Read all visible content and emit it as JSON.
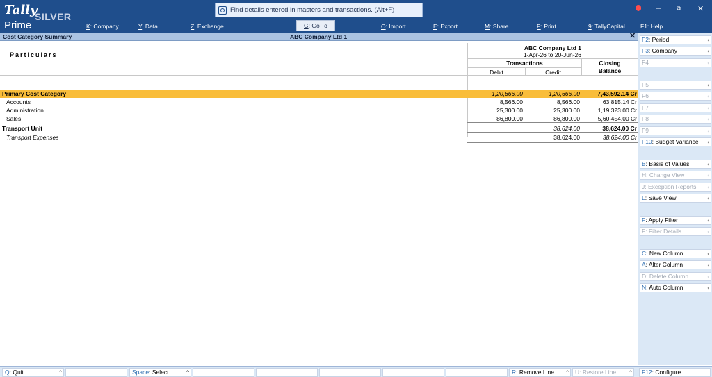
{
  "app": {
    "brand": "Tally",
    "edition": "SILVER",
    "product": "Prime",
    "search_placeholder": "Find details entered in masters and transactions. (Alt+F)"
  },
  "window_controls": {
    "minimize": "–",
    "restore": "⧉",
    "close": "✕"
  },
  "menu": [
    {
      "key": "K",
      "label": ": Company"
    },
    {
      "key": "Y",
      "label": ": Data"
    },
    {
      "key": "Z",
      "label": ": Exchange"
    },
    {
      "key": "G",
      "label": ": Go To"
    },
    {
      "key": "O",
      "label": ": Import"
    },
    {
      "key": "E",
      "label": ": Export"
    },
    {
      "key": "M",
      "label": ": Share"
    },
    {
      "key": "P",
      "label": ": Print"
    },
    {
      "key": "9",
      "label": ": TallyCapital"
    },
    {
      "key": "F1",
      "label": ": Help"
    }
  ],
  "titlebar": {
    "report": "Cost Category Summary",
    "company": "ABC Company Ltd 1",
    "close": "✕"
  },
  "report": {
    "particulars": "Particulars",
    "company": "ABC Company Ltd 1",
    "period": "1-Apr-26 to 20-Jun-26",
    "transactions": "Transactions",
    "debit": "Debit",
    "credit": "Credit",
    "closing_l1": "Closing",
    "closing_l2": "Balance",
    "rows": [
      {
        "name": "Primary Cost Category",
        "debit": "1,20,666.00",
        "credit": "1,20,666.00",
        "closing": "7,43,592.14 Cr"
      },
      {
        "name": "Accounts",
        "debit": "8,566.00",
        "credit": "8,566.00",
        "closing": "63,815.14 Cr"
      },
      {
        "name": "Administration",
        "debit": "25,300.00",
        "credit": "25,300.00",
        "closing": "1,19,323.00 Cr"
      },
      {
        "name": "Sales",
        "debit": "86,800.00",
        "credit": "86,800.00",
        "closing": "5,60,454.00 Cr"
      },
      {
        "name": "Transport Unit",
        "debit": "",
        "credit": "38,624.00",
        "closing": "38,624.00 Cr"
      },
      {
        "name": "Transport Expenses",
        "debit": "",
        "credit": "38,624.00",
        "closing": "38,624.00 Cr"
      }
    ]
  },
  "right_panel": [
    {
      "key": "F2",
      "label": ": Period",
      "enabled": true
    },
    {
      "key": "F3",
      "label": ": Company",
      "enabled": true
    },
    {
      "key": "F4",
      "label": "",
      "enabled": false
    },
    {
      "key": "F5",
      "label": "",
      "enabled": false
    },
    {
      "key": "F6",
      "label": "",
      "enabled": false
    },
    {
      "key": "F7",
      "label": "",
      "enabled": false
    },
    {
      "key": "F8",
      "label": "",
      "enabled": false
    },
    {
      "key": "F9",
      "label": "",
      "enabled": false
    },
    {
      "key": "F10",
      "label": ": Budget Variance",
      "enabled": true
    },
    {
      "key": "B",
      "label": ": Basis of Values",
      "enabled": true
    },
    {
      "key": "H",
      "label": ": Change View",
      "enabled": false
    },
    {
      "key": "J",
      "label": ": Exception Reports",
      "enabled": false
    },
    {
      "key": "L",
      "label": ": Save View",
      "enabled": true
    },
    {
      "key": "F",
      "label": ": Apply Filter",
      "enabled": true
    },
    {
      "key": "F",
      "label": ": Filter Details",
      "enabled": false
    },
    {
      "key": "C",
      "label": ": New Column",
      "enabled": true
    },
    {
      "key": "A",
      "label": ": Alter Column",
      "enabled": true
    },
    {
      "key": "D",
      "label": ": Delete Column",
      "enabled": false
    },
    {
      "key": "N",
      "label": ": Auto Column",
      "enabled": true
    }
  ],
  "bottom_bar": {
    "quit_key": "Q",
    "quit_label": ": Quit",
    "select_key": "Space",
    "select_label": ": Select",
    "remove_key": "R",
    "remove_label": ": Remove Line",
    "restore_key": "U",
    "restore_label": ": Restore Line",
    "configure_key": "F12",
    "configure_label": ": Configure"
  }
}
